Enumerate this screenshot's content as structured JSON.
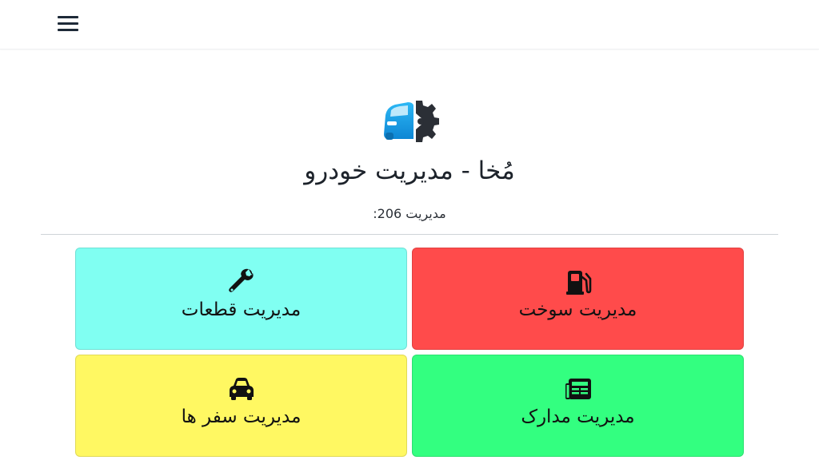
{
  "header": {
    "menu_icon": "hamburger-menu-icon"
  },
  "brand": {
    "logo_icon": "car-gear-logo-icon",
    "title": "مُخا - مدیریت خودرو",
    "subtitle": "مدیریت 206:"
  },
  "tiles": [
    {
      "label": "مدیریت سوخت",
      "icon": "fuel-pump-icon",
      "color": "#ff4b4b"
    },
    {
      "label": "مدیریت قطعات",
      "icon": "wrench-icon",
      "color": "#80fff2"
    },
    {
      "label": "مدیریت مدارک",
      "icon": "newspaper-icon",
      "color": "#33ff80"
    },
    {
      "label": "مدیریت سفر ها",
      "icon": "car-icon",
      "color": "#fff862"
    }
  ],
  "colors": {
    "logo_blue": "#1aa3e8",
    "logo_dark": "#2b2f36",
    "divider": "#cfd3d7"
  }
}
